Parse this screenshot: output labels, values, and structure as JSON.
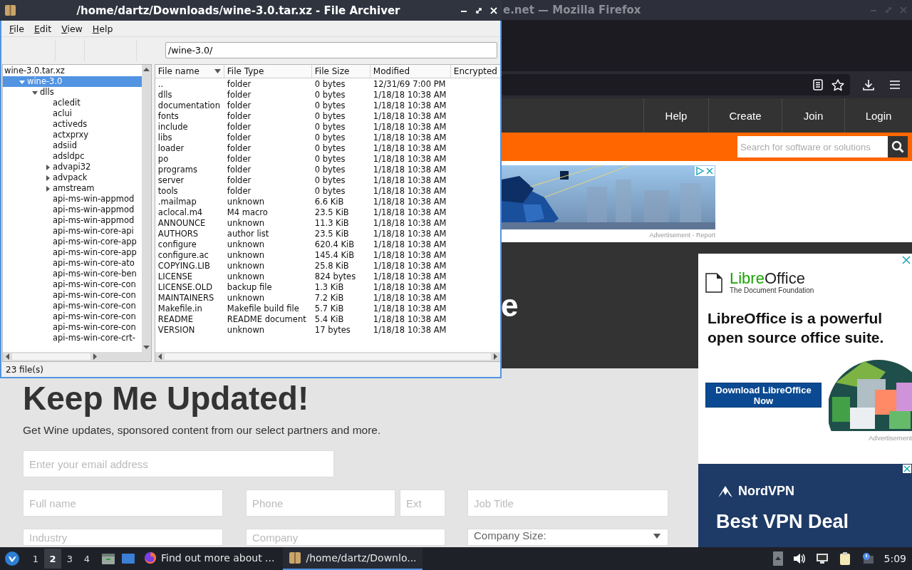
{
  "archiver": {
    "title": "/home/dartz/Downloads/wine-3.0.tar.xz - File Archiver",
    "menu": [
      "File",
      "Edit",
      "View",
      "Help"
    ],
    "path": "/wine-3.0/",
    "tree": [
      {
        "label": "wine-3.0.tar.xz",
        "selected": false,
        "children": [
          {
            "label": "wine-3.0",
            "expanded": true,
            "selected": true,
            "children": [
              {
                "label": "dlls",
                "expanded": true,
                "selected": false,
                "children": [
                  {
                    "label": "acledit",
                    "selected": false
                  },
                  {
                    "label": "aclui",
                    "selected": false
                  },
                  {
                    "label": "activeds",
                    "selected": false
                  },
                  {
                    "label": "actxprxy",
                    "selected": false
                  },
                  {
                    "label": "adsiid",
                    "selected": false
                  },
                  {
                    "label": "adsldpc",
                    "selected": false
                  },
                  {
                    "label": "advapi32",
                    "expanded": false,
                    "selected": false
                  },
                  {
                    "label": "advpack",
                    "expanded": false,
                    "selected": false
                  },
                  {
                    "label": "amstream",
                    "expanded": false,
                    "selected": false
                  },
                  {
                    "label": "api-ms-win-appmod",
                    "selected": false
                  },
                  {
                    "label": "api-ms-win-appmod",
                    "selected": false
                  },
                  {
                    "label": "api-ms-win-appmod",
                    "selected": false
                  },
                  {
                    "label": "api-ms-win-core-api",
                    "selected": false
                  },
                  {
                    "label": "api-ms-win-core-app",
                    "selected": false
                  },
                  {
                    "label": "api-ms-win-core-app",
                    "selected": false
                  },
                  {
                    "label": "api-ms-win-core-ato",
                    "selected": false
                  },
                  {
                    "label": "api-ms-win-core-ben",
                    "selected": false
                  },
                  {
                    "label": "api-ms-win-core-con",
                    "selected": false
                  },
                  {
                    "label": "api-ms-win-core-con",
                    "selected": false
                  },
                  {
                    "label": "api-ms-win-core-con",
                    "selected": false
                  },
                  {
                    "label": "api-ms-win-core-con",
                    "selected": false
                  },
                  {
                    "label": "api-ms-win-core-con",
                    "selected": false
                  },
                  {
                    "label": "api-ms-win-core-crt-",
                    "selected": false
                  }
                ]
              }
            ]
          }
        ]
      }
    ],
    "columns": [
      {
        "label": "File name",
        "sorted": true
      },
      {
        "label": "File Type",
        "sorted": false
      },
      {
        "label": "File Size",
        "sorted": false
      },
      {
        "label": "Modified",
        "sorted": false
      },
      {
        "label": "Encrypted",
        "sorted": false
      }
    ],
    "files": [
      {
        "name": "..",
        "type": "folder",
        "size": "0 bytes",
        "modified": "12/31/69 7:00 PM"
      },
      {
        "name": "dlls",
        "type": "folder",
        "size": "0 bytes",
        "modified": "1/18/18 10:38 AM"
      },
      {
        "name": "documentation",
        "type": "folder",
        "size": "0 bytes",
        "modified": "1/18/18 10:38 AM"
      },
      {
        "name": "fonts",
        "type": "folder",
        "size": "0 bytes",
        "modified": "1/18/18 10:38 AM"
      },
      {
        "name": "include",
        "type": "folder",
        "size": "0 bytes",
        "modified": "1/18/18 10:38 AM"
      },
      {
        "name": "libs",
        "type": "folder",
        "size": "0 bytes",
        "modified": "1/18/18 10:38 AM"
      },
      {
        "name": "loader",
        "type": "folder",
        "size": "0 bytes",
        "modified": "1/18/18 10:38 AM"
      },
      {
        "name": "po",
        "type": "folder",
        "size": "0 bytes",
        "modified": "1/18/18 10:38 AM"
      },
      {
        "name": "programs",
        "type": "folder",
        "size": "0 bytes",
        "modified": "1/18/18 10:38 AM"
      },
      {
        "name": "server",
        "type": "folder",
        "size": "0 bytes",
        "modified": "1/18/18 10:38 AM"
      },
      {
        "name": "tools",
        "type": "folder",
        "size": "0 bytes",
        "modified": "1/18/18 10:38 AM"
      },
      {
        "name": ".mailmap",
        "type": "unknown",
        "size": "6.6 KiB",
        "modified": "1/18/18 10:38 AM"
      },
      {
        "name": "aclocal.m4",
        "type": "M4 macro",
        "size": "23.5 KiB",
        "modified": "1/18/18 10:38 AM"
      },
      {
        "name": "ANNOUNCE",
        "type": "unknown",
        "size": "11.3 KiB",
        "modified": "1/18/18 10:38 AM"
      },
      {
        "name": "AUTHORS",
        "type": "author list",
        "size": "23.5 KiB",
        "modified": "1/18/18 10:38 AM"
      },
      {
        "name": "configure",
        "type": "unknown",
        "size": "620.4 KiB",
        "modified": "1/18/18 10:38 AM"
      },
      {
        "name": "configure.ac",
        "type": "unknown",
        "size": "145.4 KiB",
        "modified": "1/18/18 10:38 AM"
      },
      {
        "name": "COPYING.LIB",
        "type": "unknown",
        "size": "25.8 KiB",
        "modified": "1/18/18 10:38 AM"
      },
      {
        "name": "LICENSE",
        "type": "unknown",
        "size": "824 bytes",
        "modified": "1/18/18 10:38 AM"
      },
      {
        "name": "LICENSE.OLD",
        "type": "backup file",
        "size": "1.3 KiB",
        "modified": "1/18/18 10:38 AM"
      },
      {
        "name": "MAINTAINERS",
        "type": "unknown",
        "size": "7.2 KiB",
        "modified": "1/18/18 10:38 AM"
      },
      {
        "name": "Makefile.in",
        "type": "Makefile build file",
        "size": "5.7 KiB",
        "modified": "1/18/18 10:38 AM"
      },
      {
        "name": "README",
        "type": "README document",
        "size": "5.4 KiB",
        "modified": "1/18/18 10:38 AM"
      },
      {
        "name": "VERSION",
        "type": "unknown",
        "size": "17 bytes",
        "modified": "1/18/18 10:38 AM"
      }
    ],
    "status": "23 file(s)"
  },
  "browser": {
    "title": "e.net — Mozilla Firefox",
    "nav": [
      "Help",
      "Create",
      "Join",
      "Login"
    ],
    "search_placeholder": "Search for software or solutions",
    "banner_caption": "Advertisement - Report",
    "hero_fragment": "e",
    "form": {
      "heading": "Keep Me Updated!",
      "subtitle": "Get Wine updates, sponsored content from our select partners and more.",
      "fields": [
        {
          "placeholder": "Enter your email address",
          "kind": "text"
        },
        {
          "placeholder": "Full name",
          "kind": "text"
        },
        {
          "placeholder": "Phone",
          "kind": "text"
        },
        {
          "placeholder": "Ext",
          "kind": "text"
        },
        {
          "placeholder": "Job Title",
          "kind": "text"
        },
        {
          "placeholder": "Industry",
          "kind": "text"
        },
        {
          "placeholder": "Company",
          "kind": "text"
        },
        {
          "placeholder": "Company Size:",
          "kind": "select"
        }
      ]
    },
    "office_ad": {
      "brand": [
        "Libre",
        "Office"
      ],
      "foundation": "The Document Foundation",
      "headline": "LibreOffice is a powerful open source office suite.",
      "button": "Download LibreOffice Now",
      "caption": "Advertisement"
    },
    "vpn_ad": {
      "brand": "NordVPN",
      "headline": "Best VPN Deal"
    }
  },
  "taskbar": {
    "workspaces": [
      {
        "label": "1",
        "selected": false
      },
      {
        "label": "2",
        "selected": true
      },
      {
        "label": "3",
        "selected": false
      },
      {
        "label": "4",
        "selected": false
      }
    ],
    "tasks": [
      {
        "kind": "browser",
        "label": "Find out more about ...",
        "selected": false
      },
      {
        "kind": "archive",
        "label": "/home/dartz/Downlo...",
        "selected": true
      }
    ],
    "clock": "5:09"
  }
}
